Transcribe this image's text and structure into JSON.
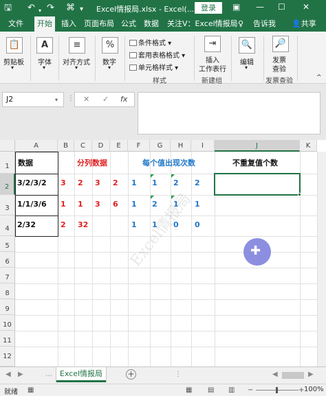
{
  "titlebar": {
    "title": "Excel情报局.xlsx  -  Excel(...",
    "login": "登录",
    "save_icon": "save-icon",
    "undo_icon": "undo-icon",
    "redo_icon": "redo-icon"
  },
  "tabs": [
    "文件",
    "开始",
    "插入",
    "页面布局",
    "公式",
    "数据",
    "关注V：Excel情报局",
    "告诉我",
    "共享"
  ],
  "active_tab": "开始",
  "ribbon": {
    "clipboard": "剪贴板",
    "font": "字体",
    "alignment": "对齐方式",
    "number": "数字",
    "conditional_format": "条件格式",
    "table_format": "套用表格格式",
    "cell_styles": "单元格样式",
    "styles_group": "样式",
    "insert_label": "插入",
    "insert_label2": "工作表行",
    "new_group": "新建组",
    "edit": "编辑",
    "invoice_check": "发票",
    "invoice_check2": "查验",
    "invoice_group": "发票查验"
  },
  "formula_bar": {
    "name_box": "J2",
    "cancel": "✕",
    "confirm": "✓",
    "fx": "fx",
    "formula": ""
  },
  "columns": [
    "A",
    "B",
    "C",
    "D",
    "E",
    "F",
    "G",
    "H",
    "I",
    "J",
    "K"
  ],
  "rows": [
    "1",
    "2",
    "3",
    "4",
    "5",
    "6",
    "7",
    "8",
    "9",
    "10",
    "11",
    "12"
  ],
  "cells": {
    "A1": "数据",
    "B1": "分列数据",
    "F1": "每个值出现次数",
    "J1": "不重复值个数",
    "A2": "3/2/3/2",
    "A3": "1/1/3/6",
    "A4": "2/32",
    "B2": "3",
    "C2": "2",
    "D2": "3",
    "E2": "2",
    "B3": "1",
    "C3": "1",
    "D3": "3",
    "E3": "6",
    "B4": "2",
    "C4": "32",
    "F2": "1",
    "G2": "1",
    "H2": "2",
    "I2": "2",
    "F3": "1",
    "G3": "2",
    "H3": "1",
    "I3": "1",
    "F4": "1",
    "G4": "1",
    "H4": "0",
    "I4": "0"
  },
  "watermark": "Excel情报局",
  "sheet_tab": "Excel情报局",
  "status": {
    "ready": "就绪",
    "zoom": "100%"
  },
  "colors": {
    "accent": "#217346",
    "red_text": "#e02020",
    "blue_text": "#1f78c8",
    "cursor": "#8c8ee0"
  }
}
